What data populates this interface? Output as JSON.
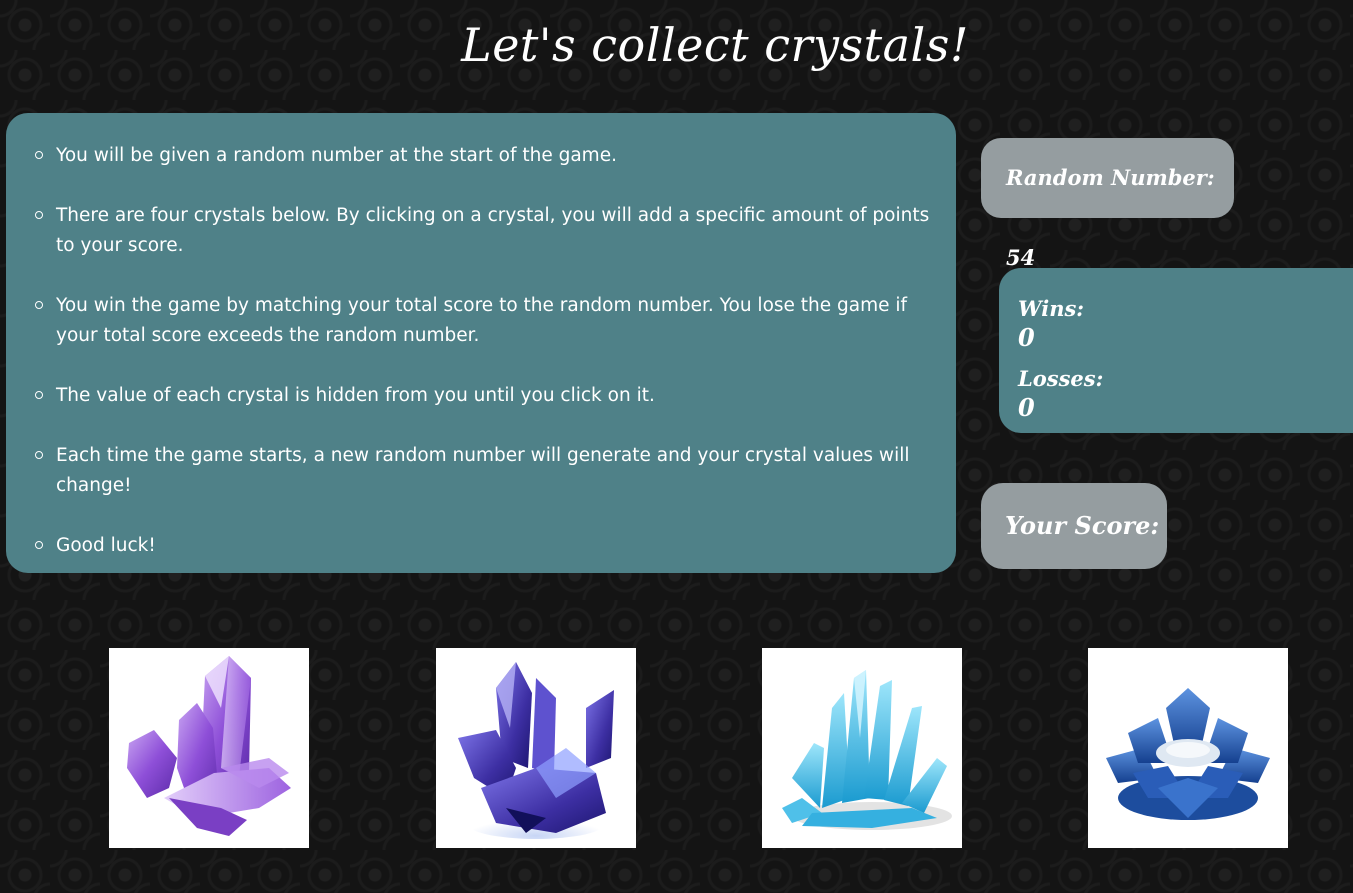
{
  "title": "Let's collect crystals!",
  "rules": [
    "You will be given a random number at the start of the game.",
    "There are four crystals below. By clicking on a crystal, you will add a specific amount of points to your score.",
    "You win the game by matching your total score to the random number. You lose the game if your total score exceeds the random number.",
    "The value of each crystal is hidden from you until you click on it.",
    "Each time the game starts, a new random number will generate and your crystal values will change!",
    "Good luck!"
  ],
  "random_number": {
    "label": "Random Number: 54",
    "value": 54
  },
  "stats": {
    "wins_label": "Wins:",
    "wins_value": "0",
    "losses_label": "Losses:",
    "losses_value": "0"
  },
  "score": {
    "label": "Your Score:",
    "value": ""
  },
  "crystals": [
    {
      "name": "purple-crystal-cluster",
      "color": "#9b5fd6"
    },
    {
      "name": "violet-faceted-crystal",
      "color": "#4b3fb0"
    },
    {
      "name": "aqua-crystal-cluster",
      "color": "#3fb3df"
    },
    {
      "name": "blue-lotus-crystal",
      "color": "#2c63b8"
    }
  ],
  "colors": {
    "panel_teal": "#4f8188",
    "panel_gray": "#959da0",
    "background": "#141414"
  }
}
